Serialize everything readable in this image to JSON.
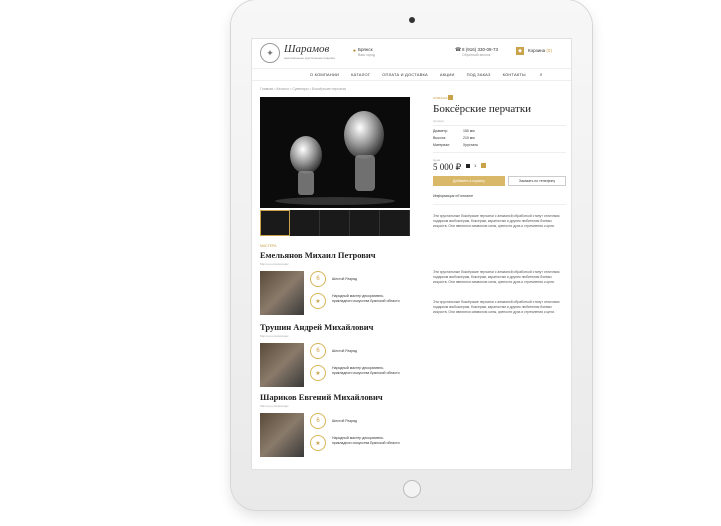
{
  "header": {
    "logo_text": "Шарамов",
    "logo_sub": "оригинальные хрустальные изделия",
    "city": "Брянск",
    "city_sub": "Ваш город",
    "phone": "8 (916) 330-08-73",
    "phone_sub": "Обратный звонок",
    "cart_label": "Корзина",
    "cart_count": "(0)"
  },
  "nav": {
    "items": [
      "О КОМПАНИИ",
      "КАТАЛОГ",
      "ОПЛАТА И ДОСТАВКА",
      "АКЦИИ",
      "ПОД ЗАКАЗ",
      "КОНТАКТЫ"
    ]
  },
  "breadcrumbs": "Главная  •  Каталог  •  Сувениры  •  Боксёрские перчатки",
  "product": {
    "badge": "НОВИНКА",
    "title": "Боксёрские перчатки",
    "article": "Артикул",
    "specs": [
      {
        "label": "Диаметр:",
        "value": "150 мм"
      },
      {
        "label": "Высота:",
        "value": "210 мм"
      },
      {
        "label": "Материал:",
        "value": "Хрусталь"
      }
    ],
    "price_label": "Цена",
    "price": "5 000 ₽",
    "qty": "1",
    "add_to_cart": "Добавить в корзину",
    "order_phone": "Заказать по телефону",
    "payment_info": "Информация об оплате",
    "description": [
      "Эти хрустальные боксёрские перчатки с алмазной обработкой станут отличным подарком кикбоксерам, боксерам, каратистам и другим любителям боевых искусств. Они являются символом силы, крепости духа и стремления к цели.",
      "Эти хрустальные боксёрские перчатки с алмазной обработкой станут отличным подарком кикбоксерам, боксерам, каратистам и другим любителям боевых искусств. Они являются символом силы, крепости духа и стремления к цели.",
      "Эти хрустальные боксёрские перчатки с алмазной обработкой станут отличным подарком кикбоксерам, боксерам, каратистам и другим любителям боевых искусств. Они являются символом силы, крепости духа и стремления к цели."
    ]
  },
  "masters": {
    "label": "МАСТЕРА",
    "list": [
      {
        "name": "Емельянов Михаил Петрович",
        "role": "Мастер-шлифовщик",
        "award1": "Шестой Разряд",
        "award2": "Народный мастер декоративно-прикладного искусства Брянской области"
      },
      {
        "name": "Трушин Андрей Михайлович",
        "role": "Мастер-шлифовщик",
        "award1": "Шестой Разряд",
        "award2": "Народный мастер декоративно-прикладного искусства Брянской области"
      },
      {
        "name": "Шариков Евгений Михайлович",
        "role": "Мастер-шлифовщик",
        "award1": "Шестой Разряд",
        "award2": "Народный мастер декоративно-прикладного искусства Брянской области"
      }
    ]
  },
  "colors": {
    "accent": "#c9a24a",
    "text": "#222222"
  }
}
